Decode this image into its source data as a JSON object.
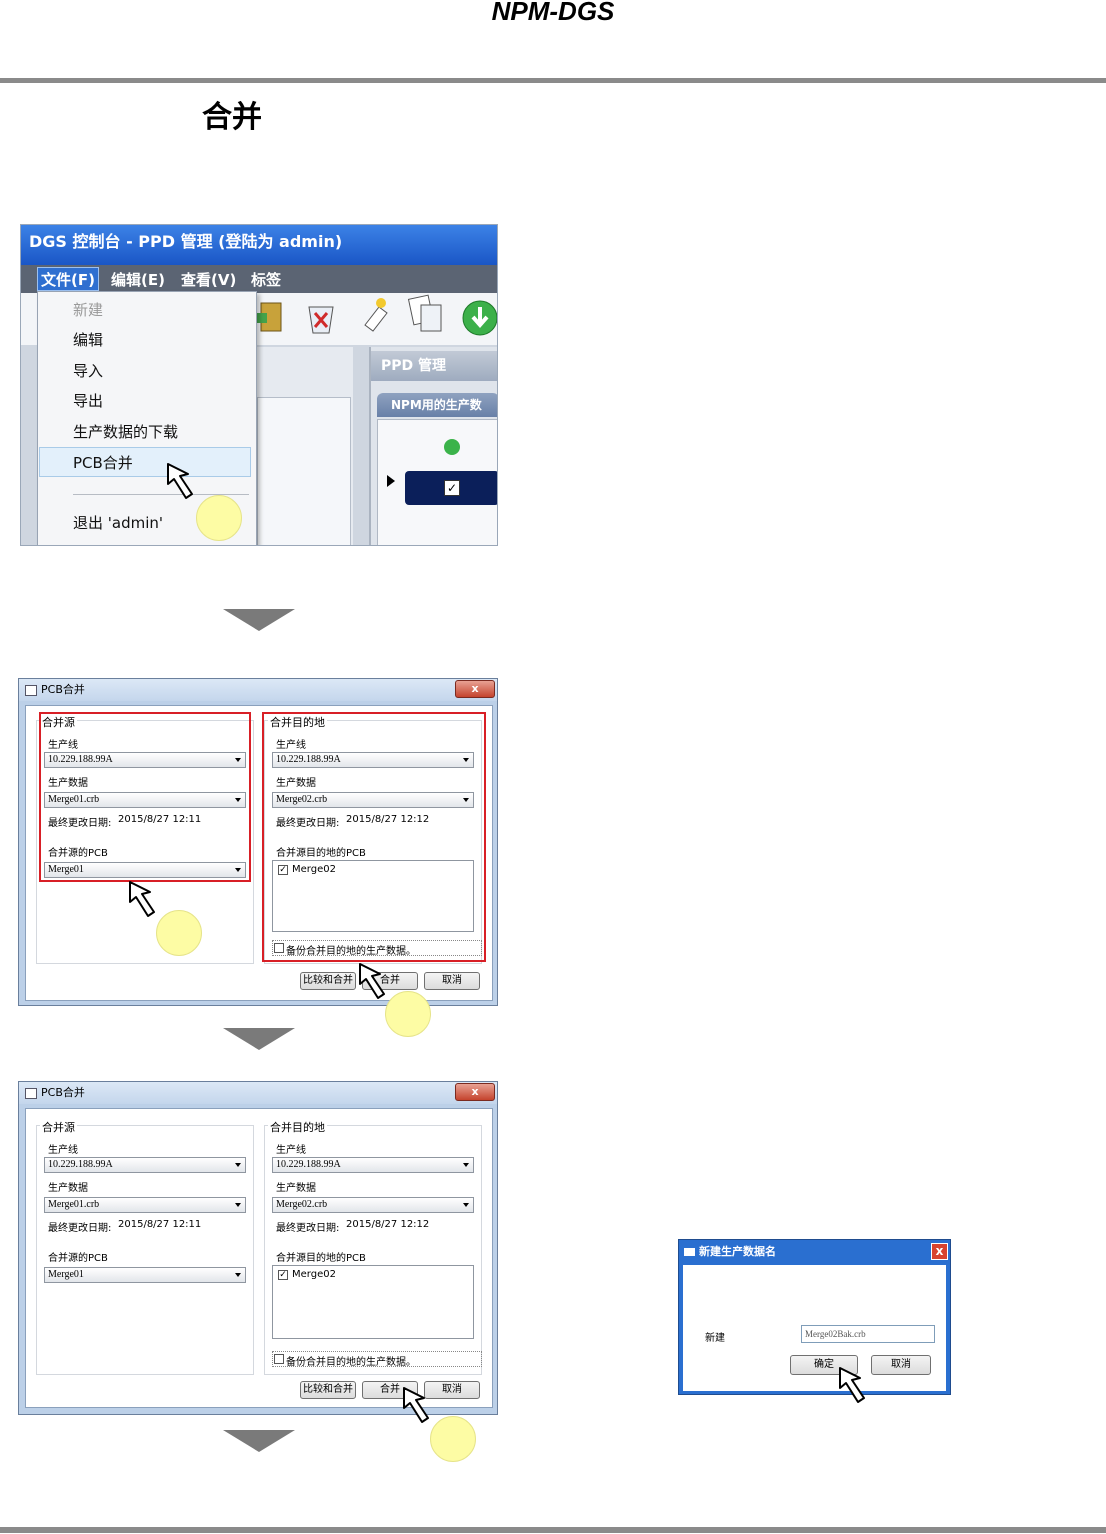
{
  "header": {
    "title": "NPM-DGS"
  },
  "section": {
    "title": "合并"
  },
  "screen1": {
    "window_title": "DGS 控制台  - PPD 管理 (登陆为 admin)",
    "menu": [
      "文件(F)",
      "编辑(E)",
      "查看(V)",
      "标签"
    ],
    "file_menu_items": [
      "新建",
      "编辑",
      "导入",
      "导出",
      "生产数据的下载",
      "PCB合并",
      "退出 'admin'"
    ],
    "ppd_header": "PPD 管理",
    "ppd_tab": "NPM用的生产数",
    "toolbar_icons": [
      "exit-door-icon",
      "delete-bin-icon",
      "new-tag-icon",
      "copy-docs-icon",
      "download-green-icon"
    ]
  },
  "merge_dialog": {
    "title": "PCB合并",
    "close_label": "x",
    "source": {
      "group_label": "合并源",
      "line_label": "生产线",
      "line_value": "10.229.188.99A",
      "data_label": "生产数据",
      "data_value": "Merge01.crb",
      "modified_label": "最终更改日期:",
      "modified_value": "2015/8/27 12:11",
      "pcb_label": "合并源的PCB",
      "pcb_value": "Merge01"
    },
    "dest": {
      "group_label": "合并目的地",
      "line_label": "生产线",
      "line_value": "10.229.188.99A",
      "data_label": "生产数据",
      "data_value": "Merge02.crb",
      "modified_label": "最终更改日期:",
      "modified_value": "2015/8/27 12:12",
      "pcb_label": "合并源目的地的PCB",
      "pcb_item": "Merge02",
      "pcb_checked": true
    },
    "backup_label": "备份合并目的地的生产数据。",
    "buttons": {
      "compare": "比较和合并",
      "merge": "合并",
      "cancel": "取消"
    }
  },
  "new_name_dialog": {
    "title": "新建生产数据名",
    "new_label": "新建",
    "input_value": "Merge02Bak.crb",
    "ok": "确定",
    "cancel": "取消",
    "close_label": "x"
  },
  "colors": {
    "red_highlight": "#d81f26",
    "marker": "#fdfca4",
    "arrow": "#7a7a7a"
  }
}
